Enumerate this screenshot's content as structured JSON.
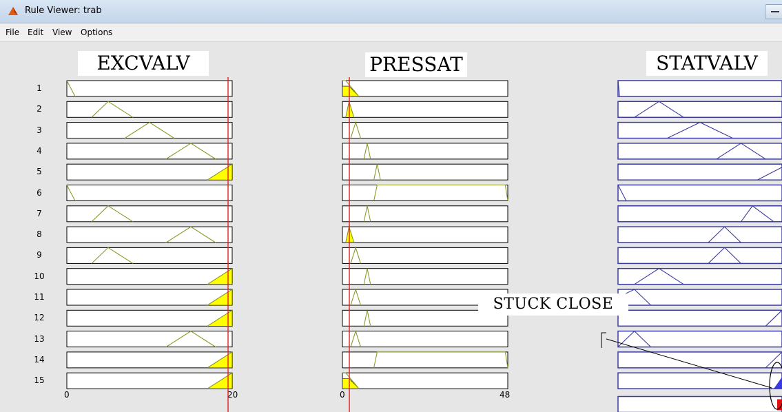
{
  "window": {
    "title": "Rule Viewer: trab"
  },
  "menu": [
    "File",
    "Edit",
    "View",
    "Options"
  ],
  "columns": [
    {
      "title": "EXCVALV",
      "xmin": "0",
      "xmax": "20",
      "input_value_label": ""
    },
    {
      "title": "PRESSAT",
      "xmin": "0",
      "xmax": "48",
      "input_value_label": ""
    },
    {
      "title": "STATVALV"
    }
  ],
  "rows": [
    "1",
    "2",
    "3",
    "4",
    "5",
    "6",
    "7",
    "8",
    "9",
    "10",
    "11",
    "12",
    "13",
    "14",
    "15"
  ],
  "annotation": {
    "label": "STUCK CLOSE"
  },
  "colors": {
    "input_mf": "#8a9a2a",
    "fill": "#ffff00",
    "output_mf": "#3a3aa0",
    "marker_line": "#e02020",
    "aggregate_fill": "#3a3ae0"
  }
}
